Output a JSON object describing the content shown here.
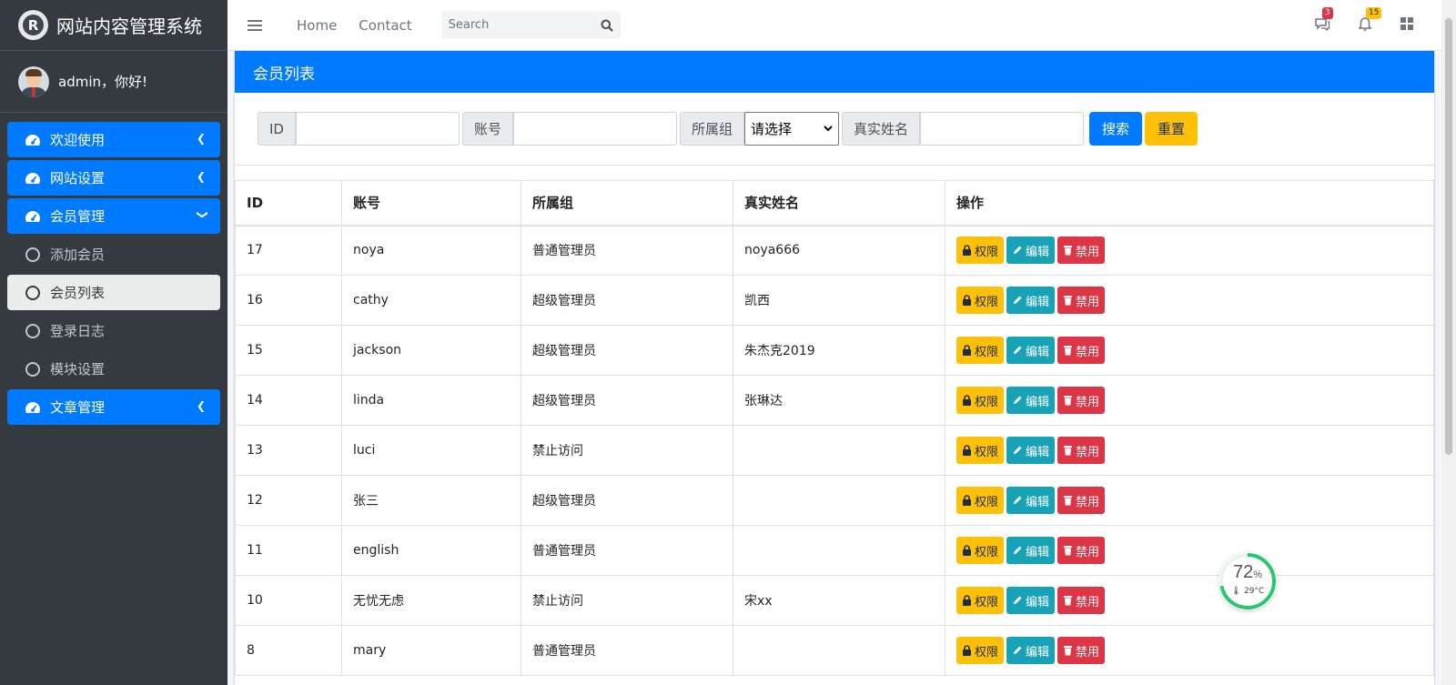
{
  "brand": {
    "logo_letter": "R",
    "title": "网站内容管理系统"
  },
  "user": {
    "greeting": "admin，你好!"
  },
  "sidebar": {
    "items": [
      {
        "label": "欢迎使用",
        "icon": "tachometer-icon",
        "active": true
      },
      {
        "label": "网站设置",
        "icon": "tachometer-icon",
        "active": true
      },
      {
        "label": "会员管理",
        "icon": "tachometer-icon",
        "active": true,
        "expanded": true
      },
      {
        "label": "添加会员",
        "icon": "circle-icon"
      },
      {
        "label": "会员列表",
        "icon": "circle-icon",
        "current": true
      },
      {
        "label": "登录日志",
        "icon": "circle-icon"
      },
      {
        "label": "模块设置",
        "icon": "circle-icon"
      },
      {
        "label": "文章管理",
        "icon": "tachometer-icon",
        "active": true
      }
    ]
  },
  "topbar": {
    "home": "Home",
    "contact": "Contact",
    "search_placeholder": "Search",
    "messages_count": "3",
    "notifications_count": "15"
  },
  "card": {
    "title": "会员列表"
  },
  "filter": {
    "id_label": "ID",
    "account_label": "账号",
    "group_label": "所属组",
    "group_select": "请选择",
    "realname_label": "真实姓名",
    "search_button": "搜索",
    "reset_button": "重置"
  },
  "table": {
    "headers": [
      "ID",
      "账号",
      "所属组",
      "真实姓名",
      "操作"
    ],
    "actions": {
      "perm": "权限",
      "edit": "编辑",
      "ban": "禁用"
    },
    "rows": [
      [
        "17",
        "noya",
        "普通管理员",
        "noya666"
      ],
      [
        "16",
        "cathy",
        "超级管理员",
        "凯西"
      ],
      [
        "15",
        "jackson",
        "超级管理员",
        "朱杰克2019"
      ],
      [
        "14",
        "linda",
        "超级管理员",
        "张琳达"
      ],
      [
        "13",
        "luci",
        "禁止访问",
        ""
      ],
      [
        "12",
        "张三",
        "超级管理员",
        ""
      ],
      [
        "11",
        "english",
        "普通管理员",
        ""
      ],
      [
        "10",
        "无忧无虑",
        "禁止访问",
        "宋xx"
      ],
      [
        "8",
        "mary",
        "普通管理员",
        ""
      ]
    ]
  },
  "widget": {
    "percent": "72",
    "percent_sign": "%",
    "temperature": "29°C"
  },
  "colors": {
    "primary": "#007bff",
    "warning": "#ffc107",
    "info": "#17a2b8",
    "danger": "#dc3545",
    "sidebar": "#343a40"
  }
}
